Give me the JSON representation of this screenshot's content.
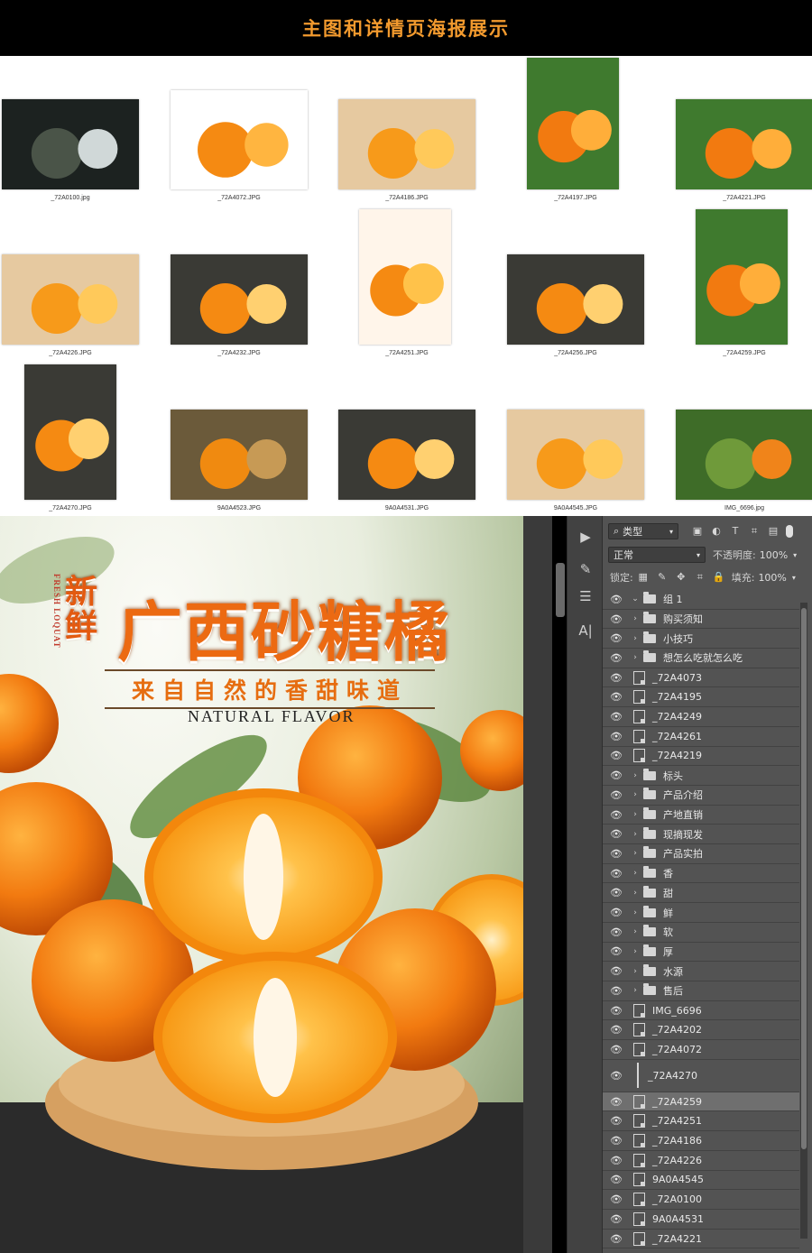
{
  "banner": {
    "title": "主图和详情页海报展示"
  },
  "thumbnails": [
    {
      "label": "_72A0100.jpg",
      "theme": "waterfall"
    },
    {
      "label": "_72A4072.JPG",
      "theme": "white"
    },
    {
      "label": "_72A4186.JPG",
      "theme": "peeled"
    },
    {
      "label": "_72A4197.JPG",
      "theme": "leafy"
    },
    {
      "label": "_72A4221.JPG",
      "theme": "leafy"
    },
    {
      "label": "_72A4226.JPG",
      "theme": "peeled"
    },
    {
      "label": "_72A4232.JPG",
      "theme": "halves"
    },
    {
      "label": "_72A4251.JPG",
      "theme": "plate"
    },
    {
      "label": "_72A4256.JPG",
      "theme": "halves"
    },
    {
      "label": "_72A4259.JPG",
      "theme": "leafy"
    },
    {
      "label": "_72A4270.JPG",
      "theme": "halves"
    },
    {
      "label": "9A0A4523.JPG",
      "theme": "basket"
    },
    {
      "label": "9A0A4531.JPG",
      "theme": "halves"
    },
    {
      "label": "9A0A4545.JPG",
      "theme": "peeled"
    },
    {
      "label": "IMG_6696.jpg",
      "theme": "orchard"
    }
  ],
  "poster": {
    "side_text": "FRESH LOQUAT",
    "title_prefix": "新鲜",
    "title": "广西砂糖橘",
    "subtitle": "来自自然的香甜味道",
    "english": "NATURAL FLAVOR"
  },
  "layers_panel": {
    "filter_label": "类型",
    "blend_mode": "正常",
    "opacity_label": "不透明度:",
    "opacity_value": "100%",
    "lock_label": "锁定:",
    "fill_label": "填充:",
    "fill_value": "100%",
    "layers": [
      {
        "name": "组 1",
        "type": "group",
        "expanded": true
      },
      {
        "name": "购买须知",
        "type": "group"
      },
      {
        "name": "小技巧",
        "type": "group"
      },
      {
        "name": "想怎么吃就怎么吃",
        "type": "group"
      },
      {
        "name": "_72A4073",
        "type": "smart"
      },
      {
        "name": "_72A4195",
        "type": "smart"
      },
      {
        "name": "_72A4249",
        "type": "smart"
      },
      {
        "name": "_72A4261",
        "type": "smart"
      },
      {
        "name": "_72A4219",
        "type": "smart"
      },
      {
        "name": "标头",
        "type": "group"
      },
      {
        "name": "产品介绍",
        "type": "group"
      },
      {
        "name": "产地直销",
        "type": "group"
      },
      {
        "name": "现摘现发",
        "type": "group"
      },
      {
        "name": "产品实拍",
        "type": "group"
      },
      {
        "name": "香",
        "type": "group"
      },
      {
        "name": "甜",
        "type": "group"
      },
      {
        "name": "鲜",
        "type": "group"
      },
      {
        "name": "软",
        "type": "group"
      },
      {
        "name": "厚",
        "type": "group"
      },
      {
        "name": "水源",
        "type": "group"
      },
      {
        "name": "售后",
        "type": "group"
      },
      {
        "name": "IMG_6696",
        "type": "smart"
      },
      {
        "name": "_72A4202",
        "type": "smart"
      },
      {
        "name": "_72A4072",
        "type": "smart"
      },
      {
        "name": "_72A4270",
        "type": "thin"
      },
      {
        "name": "_72A4259",
        "type": "smart",
        "selected": true
      },
      {
        "name": "_72A4251",
        "type": "smart"
      },
      {
        "name": "_72A4186",
        "type": "smart"
      },
      {
        "name": "_72A4226",
        "type": "smart"
      },
      {
        "name": "9A0A4545",
        "type": "smart"
      },
      {
        "name": "_72A0100",
        "type": "smart"
      },
      {
        "name": "9A0A4531",
        "type": "smart"
      },
      {
        "name": "_72A4221",
        "type": "smart"
      }
    ]
  },
  "colors": {
    "accent": "#f29a2e",
    "title_orange": "#ec6a12",
    "panel_bg": "#535353"
  }
}
